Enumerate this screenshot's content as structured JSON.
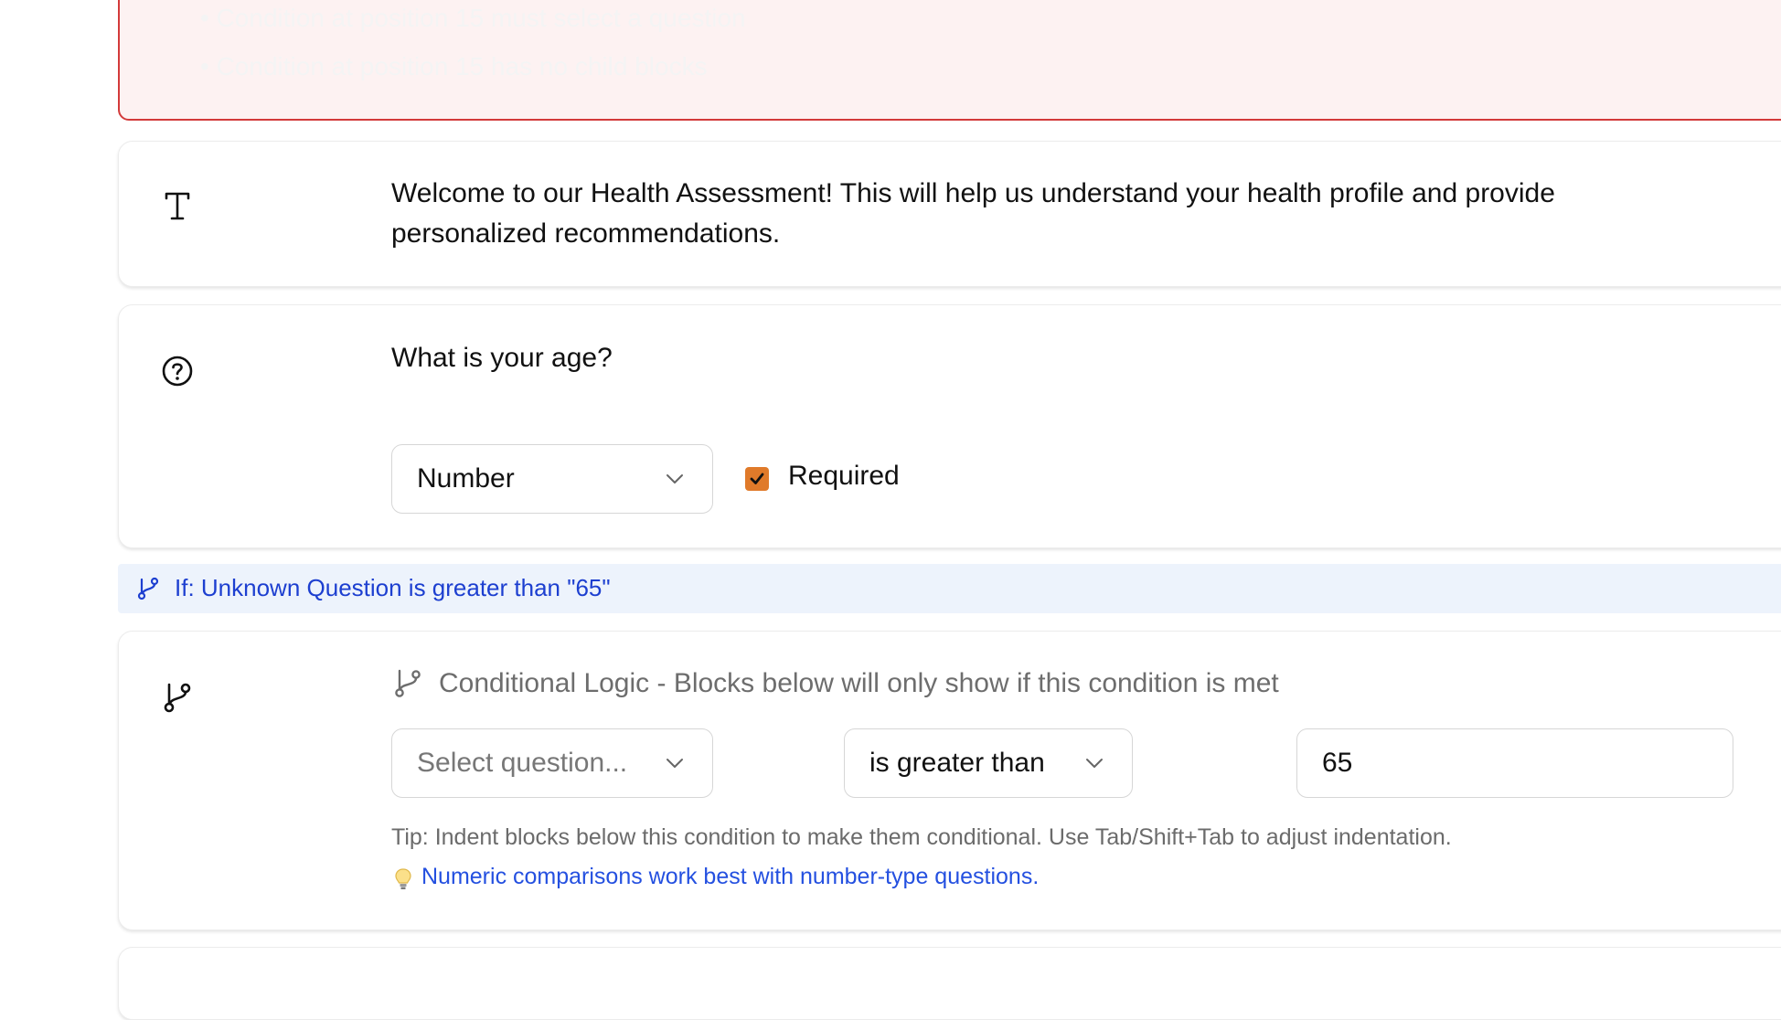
{
  "errors": [
    "• Condition at position 15 must select a question",
    "• Condition at position 15 has no child blocks"
  ],
  "text_block": {
    "icon": "text-type-icon",
    "line1": "Welcome to our Health Assessment! This will help us understand your health profile and provide",
    "line2": "personalized recommendations."
  },
  "question_block": {
    "icon": "question-circle-icon",
    "question": "What is your age?",
    "type_select": "Number",
    "required_checked": true,
    "required_label": "Required"
  },
  "condition_banner": {
    "icon": "git-branch-icon",
    "text": "If: Unknown Question is greater than \"65\""
  },
  "conditional_block": {
    "icon": "git-branch-icon",
    "title": "Conditional Logic - Blocks below will only show if this condition is met",
    "question_select_placeholder": "Select question...",
    "operator_select": "is greater than",
    "value_input": "65",
    "tip": "Tip: Indent blocks below this condition to make them conditional. Use Tab/Shift+Tab to adjust indentation.",
    "hint_icon": "lightbulb-icon",
    "hint": "Numeric comparisons work best with number-type questions."
  },
  "colors": {
    "error_border": "#d33a3a",
    "error_bg": "#fdf2f2",
    "checkbox_accent": "#e07a2a",
    "link_blue": "#1d3fd0",
    "banner_bg": "#edf3fc"
  }
}
